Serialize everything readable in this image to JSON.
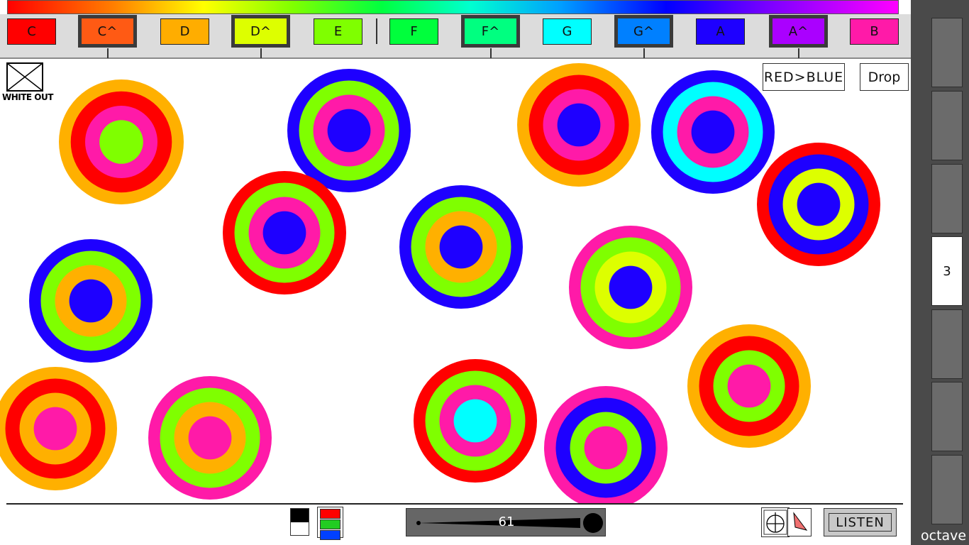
{
  "keys": [
    {
      "label": "C",
      "color": "#ff0000",
      "sharp": false
    },
    {
      "label": "C^",
      "color": "#ff5a14",
      "sharp": true
    },
    {
      "label": "D",
      "color": "#ffad00",
      "sharp": false
    },
    {
      "label": "D^",
      "color": "#ddff00",
      "sharp": true
    },
    {
      "label": "E",
      "color": "#7fff00",
      "sharp": false
    },
    {
      "label": "F",
      "color": "#00ff3c",
      "sharp": false
    },
    {
      "label": "F^",
      "color": "#00ff80",
      "sharp": true
    },
    {
      "label": "G",
      "color": "#00ffff",
      "sharp": false
    },
    {
      "label": "G^",
      "color": "#0080ff",
      "sharp": true
    },
    {
      "label": "A",
      "color": "#1e00ff",
      "sharp": false
    },
    {
      "label": "A^",
      "color": "#aa00ff",
      "sharp": true
    },
    {
      "label": "B",
      "color": "#ff1aa8",
      "sharp": false
    }
  ],
  "toolbar": {
    "white_out": "WHITE OUT",
    "red_blue": "RED>BLUE",
    "drop": "Drop"
  },
  "octave": {
    "label": "octave",
    "selected": "3"
  },
  "bottom": {
    "slider_value": "61",
    "listen": "LISTEN"
  },
  "colors": {
    "red": "#ff0000",
    "orange": "#ffb000",
    "yellow": "#ddff00",
    "green": "#7fff00",
    "cyan": "#00ffff",
    "blue": "#1e00ff",
    "pink": "#ff1aa8"
  },
  "circles": [
    [
      "orange",
      "red",
      "pink",
      "green"
    ],
    [
      "blue",
      "green",
      "pink",
      "blue"
    ],
    [
      "orange",
      "red",
      "pink",
      "blue"
    ],
    [
      "blue",
      "cyan",
      "pink",
      "blue"
    ],
    [
      "red",
      "blue",
      "yellow",
      "blue"
    ],
    [
      "blue",
      "green",
      "orange",
      "blue"
    ],
    [
      "red",
      "green",
      "pink",
      "blue"
    ],
    [
      "blue",
      "green",
      "orange",
      "blue"
    ],
    [
      "pink",
      "green",
      "yellow",
      "blue"
    ],
    [
      "orange",
      "red",
      "green",
      "pink"
    ],
    [
      "orange",
      "red",
      "orange",
      "pink"
    ],
    [
      "pink",
      "green",
      "orange",
      "pink"
    ],
    [
      "red",
      "green",
      "pink",
      "cyan"
    ],
    [
      "pink",
      "blue",
      "green",
      "pink"
    ]
  ]
}
